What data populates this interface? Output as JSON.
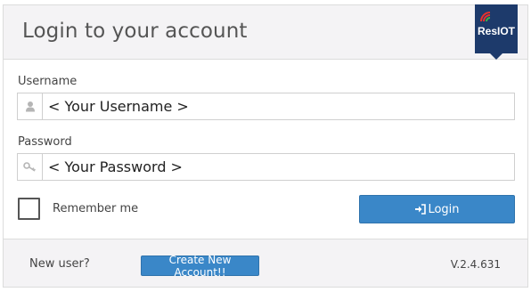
{
  "header": {
    "title": "Login to your account",
    "logo_text": "ResIOT"
  },
  "form": {
    "username_label": "Username",
    "username_placeholder": "< Your Username >",
    "password_label": "Password",
    "password_placeholder": "< Your Password >",
    "remember_label": "Remember me",
    "remember_checked": false,
    "login_label": "Login"
  },
  "footer": {
    "new_user_text": "New user?",
    "create_account_label": "Create New Account!!",
    "version": "V.2.4.631"
  },
  "icons": {
    "username": "user-icon",
    "password": "key-icon",
    "login": "sign-in-icon"
  },
  "colors": {
    "accent": "#3a87c8",
    "logo_background": "#1d3a6b",
    "header_background": "#f4f3f5"
  }
}
